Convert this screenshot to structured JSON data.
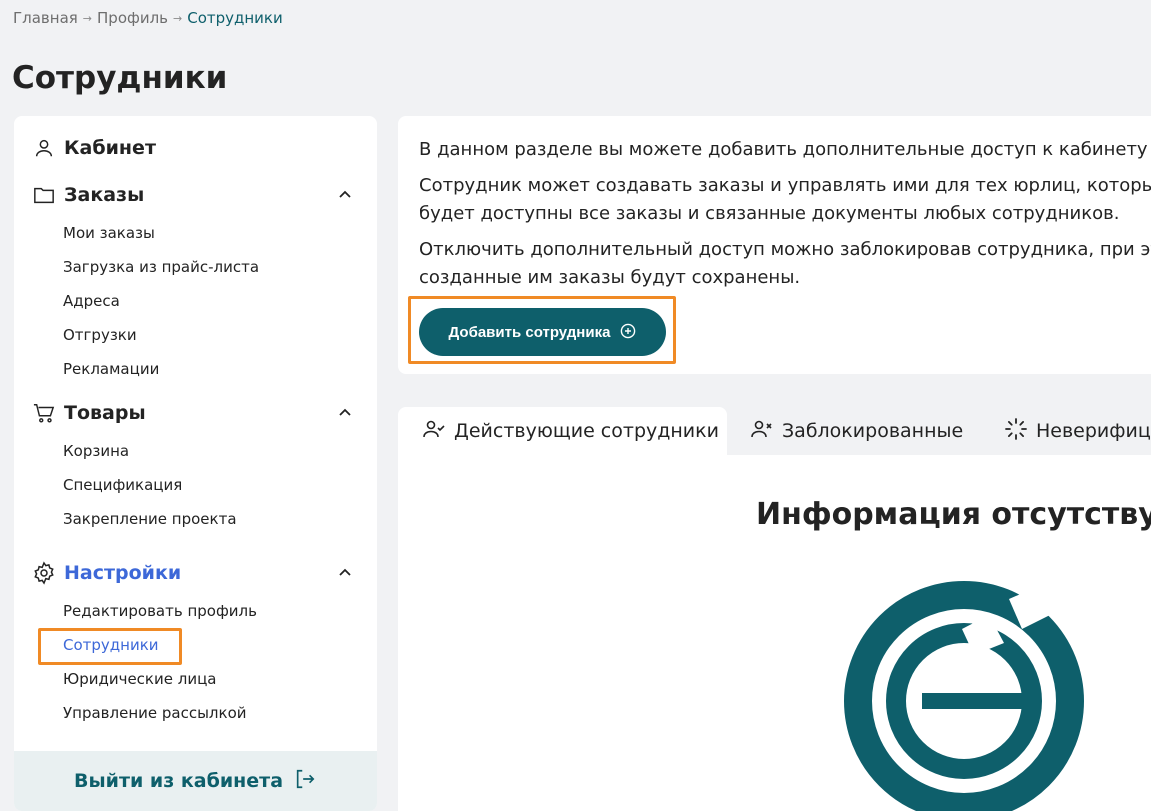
{
  "breadcrumb": {
    "items": [
      "Главная",
      "Профиль"
    ],
    "current": "Сотрудники"
  },
  "page": {
    "title": "Сотрудники"
  },
  "sidebar": {
    "sections": [
      {
        "label": "Кабинет",
        "icon": "user-icon"
      },
      {
        "label": "Заказы",
        "icon": "folder-icon",
        "expanded": true,
        "items": [
          "Мои заказы",
          "Загрузка из прайс-листа",
          "Адреса",
          "Отгрузки",
          "Рекламации"
        ]
      },
      {
        "label": "Товары",
        "icon": "cart-icon",
        "expanded": true,
        "items": [
          "Корзина",
          "Спецификация",
          "Закрепление проекта"
        ]
      },
      {
        "label": "Настройки",
        "icon": "gear-icon",
        "expanded": true,
        "active": true,
        "items": [
          "Редактировать профиль",
          "Сотрудники",
          "Юридические лица",
          "Управление рассылкой"
        ],
        "active_item": "Сотрудники"
      }
    ],
    "logout_label": "Выйти из кабинета"
  },
  "info": {
    "p1": "В данном разделе вы можете добавить дополнительные доступ к кабинету ко",
    "p2a": "Сотрудник может создавать заказы и управлять ими для тех юрлиц, которые",
    "p2b": "будет доступны все заказы и связанные документы любых сотрудников.",
    "p3a": "Отключить дополнительный доступ можно заблокировав сотрудника, при это",
    "p3b": "созданные им заказы будут сохранены.",
    "add_button": "Добавить сотрудника"
  },
  "tabs": [
    {
      "label": "Действующие сотрудники",
      "icon": "user-check-icon",
      "active": true
    },
    {
      "label": "Заблокированные",
      "icon": "user-x-icon",
      "active": false
    },
    {
      "label": "Неверифици",
      "icon": "loader-icon",
      "active": false
    }
  ],
  "content": {
    "empty_title": "Информация отсутствует"
  },
  "colors": {
    "brand": "#0e5f6b",
    "active_link": "#3d68d8",
    "highlight": "#f08a25",
    "background": "#f1f2f4"
  }
}
